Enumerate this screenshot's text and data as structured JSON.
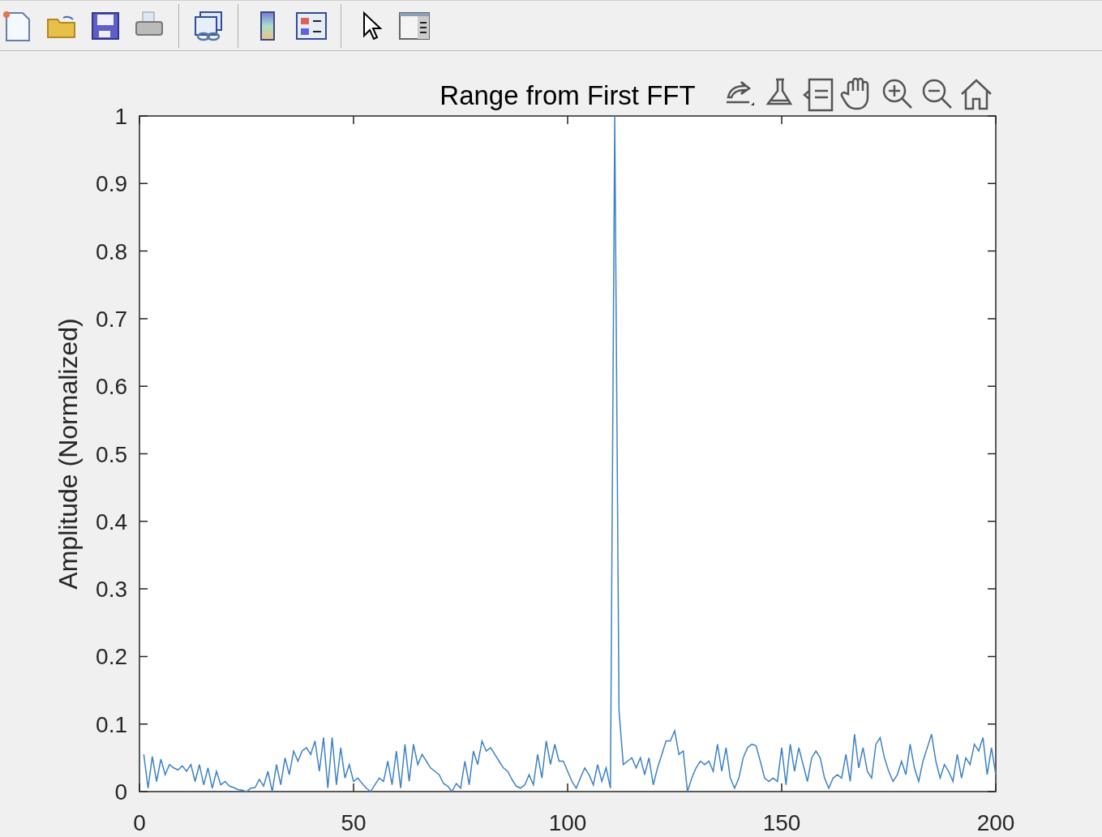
{
  "axes": {
    "title": "Range from First FFT",
    "chart_data": {
      "type": "line",
      "ylabel": "Amplitude (Normalized)",
      "xlim": [
        0,
        200
      ],
      "ylim": [
        0,
        1
      ],
      "xticks": [
        0,
        50,
        100,
        150,
        200
      ],
      "yticks": [
        0,
        0.1,
        0.2,
        0.3,
        0.4,
        0.5,
        0.6,
        0.7,
        0.8,
        0.9,
        1
      ],
      "x": [
        1,
        2,
        3,
        4,
        5,
        6,
        7,
        8,
        9,
        10,
        11,
        12,
        13,
        14,
        15,
        16,
        17,
        18,
        19,
        20,
        21,
        22,
        23,
        24,
        25,
        26,
        27,
        28,
        29,
        30,
        31,
        32,
        33,
        34,
        35,
        36,
        37,
        38,
        39,
        40,
        41,
        42,
        43,
        44,
        45,
        46,
        47,
        48,
        49,
        50,
        51,
        52,
        53,
        54,
        55,
        56,
        57,
        58,
        59,
        60,
        61,
        62,
        63,
        64,
        65,
        66,
        67,
        68,
        69,
        70,
        71,
        72,
        73,
        74,
        75,
        76,
        77,
        78,
        79,
        80,
        81,
        82,
        83,
        84,
        85,
        86,
        87,
        88,
        89,
        90,
        91,
        92,
        93,
        94,
        95,
        96,
        97,
        98,
        99,
        100,
        101,
        102,
        103,
        104,
        105,
        106,
        107,
        108,
        109,
        110,
        111,
        112,
        113,
        114,
        115,
        116,
        117,
        118,
        119,
        120,
        121,
        122,
        123,
        124,
        125,
        126,
        127,
        128,
        129,
        130,
        131,
        132,
        133,
        134,
        135,
        136,
        137,
        138,
        139,
        140,
        141,
        142,
        143,
        144,
        145,
        146,
        147,
        148,
        149,
        150,
        151,
        152,
        153,
        154,
        155,
        156,
        157,
        158,
        159,
        160,
        161,
        162,
        163,
        164,
        165,
        166,
        167,
        168,
        169,
        170,
        171,
        172,
        173,
        174,
        175,
        176,
        177,
        178,
        179,
        180,
        181,
        182,
        183,
        184,
        185,
        186,
        187,
        188,
        189,
        190,
        191,
        192,
        193,
        194,
        195,
        196,
        197,
        198,
        199,
        200
      ],
      "series": [
        {
          "color": "#3d82c6",
          "values": [
            0.055,
            0.005,
            0.052,
            0.015,
            0.048,
            0.025,
            0.04,
            0.035,
            0.032,
            0.038,
            0.03,
            0.04,
            0.015,
            0.04,
            0.01,
            0.035,
            0.005,
            0.03,
            0.01,
            0.015,
            0.008,
            0.006,
            0.003,
            0.002,
            0,
            0.005,
            0.006,
            0.018,
            0.008,
            0.03,
            0,
            0.04,
            0.01,
            0.05,
            0.025,
            0.06,
            0.045,
            0.06,
            0.065,
            0.055,
            0.075,
            0.03,
            0.08,
            0.005,
            0.08,
            0.01,
            0.065,
            0.02,
            0.04,
            0.015,
            0.02,
            0.012,
            0.005,
            0,
            0.01,
            0.02,
            0.015,
            0.045,
            0.01,
            0.06,
            0.005,
            0.07,
            0.015,
            0.07,
            0.04,
            0.055,
            0.045,
            0.035,
            0.03,
            0.025,
            0.012,
            0.008,
            0,
            0.012,
            0.005,
            0.045,
            0.01,
            0.06,
            0.04,
            0.075,
            0.06,
            0.065,
            0.055,
            0.045,
            0.035,
            0.03,
            0.018,
            0.008,
            0.005,
            0.01,
            0.025,
            0.01,
            0.055,
            0.02,
            0.075,
            0.04,
            0.07,
            0.045,
            0.045,
            0.03,
            0.015,
            0.005,
            0.02,
            0.035,
            0.025,
            0.01,
            0.04,
            0.015,
            0.035,
            0.005,
            1,
            0.12,
            0.04,
            0.045,
            0.05,
            0.035,
            0.05,
            0.025,
            0.05,
            0.01,
            0.035,
            0.055,
            0.075,
            0.075,
            0.09,
            0.055,
            0.06,
            0,
            0.02,
            0.035,
            0.045,
            0.04,
            0.045,
            0.03,
            0.07,
            0.03,
            0.065,
            0.02,
            0.005,
            0.02,
            0.05,
            0.065,
            0.07,
            0.068,
            0.045,
            0.02,
            0.015,
            0.02,
            0.015,
            0.065,
            0.01,
            0.07,
            0.03,
            0.065,
            0.04,
            0.015,
            0.05,
            0.06,
            0.05,
            0.02,
            0.005,
            0.02,
            0.025,
            0.02,
            0.055,
            0.015,
            0.085,
            0.035,
            0.065,
            0.03,
            0.02,
            0.07,
            0.08,
            0.05,
            0.03,
            0.015,
            0.025,
            0.045,
            0.025,
            0.07,
            0.035,
            0.015,
            0.045,
            0.065,
            0.085,
            0.045,
            0.02,
            0.04,
            0.03,
            0.015,
            0.055,
            0.02,
            0.05,
            0.04,
            0.07,
            0.06,
            0.08,
            0.025,
            0.065,
            0.025
          ]
        }
      ]
    }
  }
}
